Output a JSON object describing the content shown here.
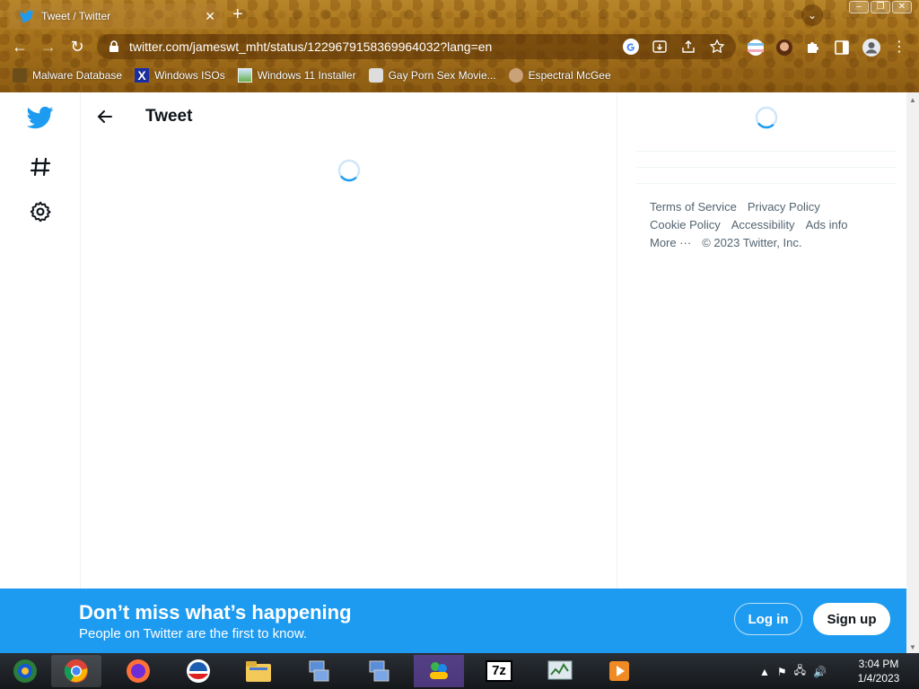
{
  "browser": {
    "tab_title": "Tweet / Twitter",
    "tab_close": "✕",
    "new_tab": "+",
    "url": "twitter.com/jameswt_mht/status/1229679158369964032?lang=en",
    "bookmarks": [
      {
        "label": "Malware Database",
        "icon": "malware-icon"
      },
      {
        "label": "Windows ISOs",
        "icon": "x-icon"
      },
      {
        "label": "Windows 11 Installer",
        "icon": "installer-icon"
      },
      {
        "label": "Gay Porn Sex Movie...",
        "icon": "camera-icon"
      },
      {
        "label": "Espectral McGee",
        "icon": "avatar-icon"
      }
    ]
  },
  "page": {
    "header_title": "Tweet",
    "footer": {
      "terms": "Terms of Service",
      "privacy": "Privacy Policy",
      "cookie": "Cookie Policy",
      "accessibility": "Accessibility",
      "ads": "Ads info",
      "more": "More ···",
      "copyright": "© 2023 Twitter, Inc."
    }
  },
  "banner": {
    "title": "Don’t miss what’s happening",
    "subtitle": "People on Twitter are the first to know.",
    "login_label": "Log in",
    "signup_label": "Sign up"
  },
  "taskbar": {
    "time": "3:04 PM",
    "date": "1/4/2023",
    "items": [
      "chrome-alt",
      "chrome",
      "firefox",
      "obama",
      "file-explorer",
      "network",
      "network-2",
      "msn-messenger",
      "7zip",
      "task-manager",
      "media-player"
    ]
  },
  "colors": {
    "twitter_blue": "#1d9bf0",
    "text_primary": "#0f1419",
    "text_secondary": "#536471"
  }
}
